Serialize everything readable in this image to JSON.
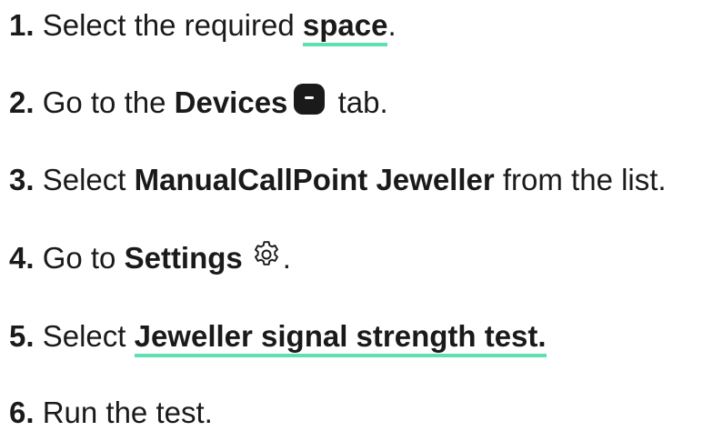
{
  "steps": [
    {
      "num": "1.",
      "pre": "Select the required ",
      "link": "space",
      "post": "."
    },
    {
      "num": "2.",
      "pre": "Go to the ",
      "bold": "Devices",
      "post": " tab.",
      "icon": "devices-icon"
    },
    {
      "num": "3.",
      "pre": "Select ",
      "bold": "ManualCallPoint Jeweller",
      "post": " from the list."
    },
    {
      "num": "4.",
      "pre": "Go to ",
      "bold": "Settings",
      "post": ".",
      "icon": "gear-icon"
    },
    {
      "num": "5.",
      "pre": "Select ",
      "link": "Jeweller signal strength test."
    },
    {
      "num": "6.",
      "pre": "Run the test."
    }
  ],
  "colors": {
    "text": "#1a1a1a",
    "link_underline": "#5fe0b1"
  }
}
